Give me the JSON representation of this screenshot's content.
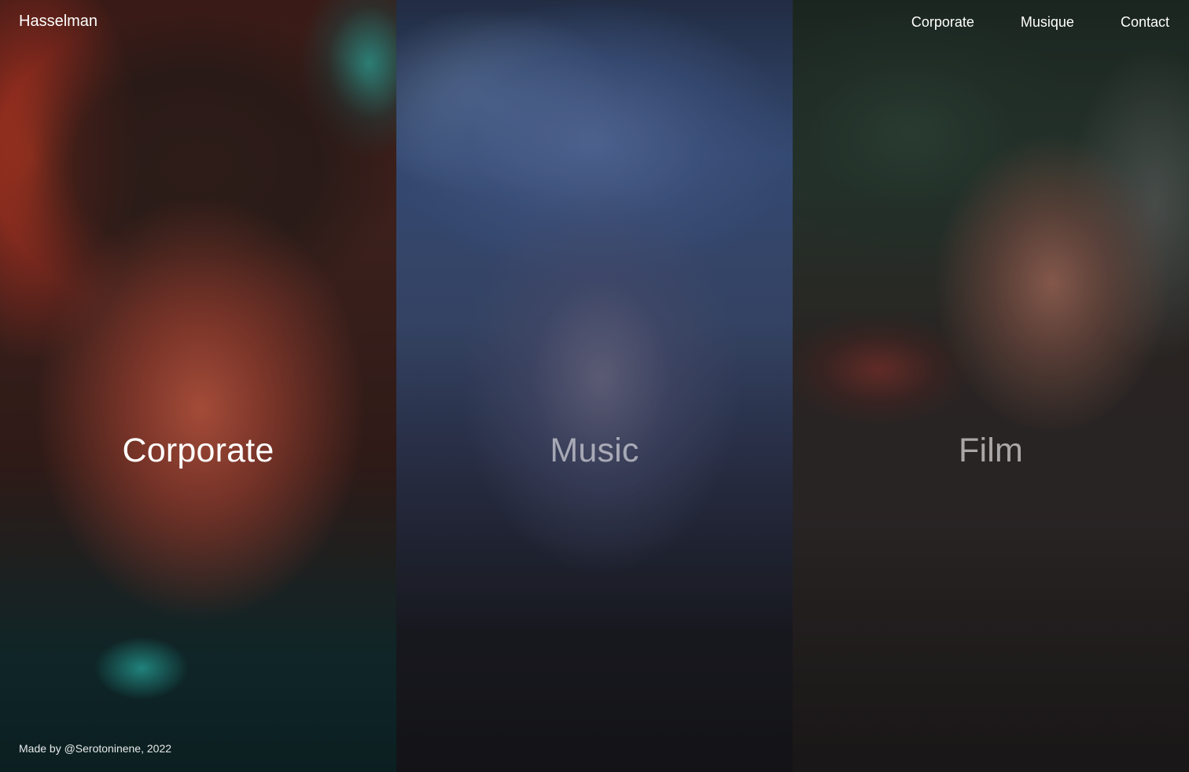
{
  "header": {
    "brand": "Hasselman",
    "nav": [
      {
        "label": "Corporate"
      },
      {
        "label": "Musique"
      },
      {
        "label": "Contact"
      }
    ]
  },
  "panels": [
    {
      "label": "Corporate",
      "image": "portrait-red-teal",
      "state": "active"
    },
    {
      "label": "Music",
      "image": "portrait-motion-blur-blue",
      "state": "dimmed"
    },
    {
      "label": "Film",
      "image": "hands-close-up",
      "state": "dimmed"
    }
  ],
  "footer": {
    "credit": "Made by @Serotoninene, 2022"
  },
  "colors": {
    "text": "#ffffff",
    "background": "#0d0d0f"
  }
}
